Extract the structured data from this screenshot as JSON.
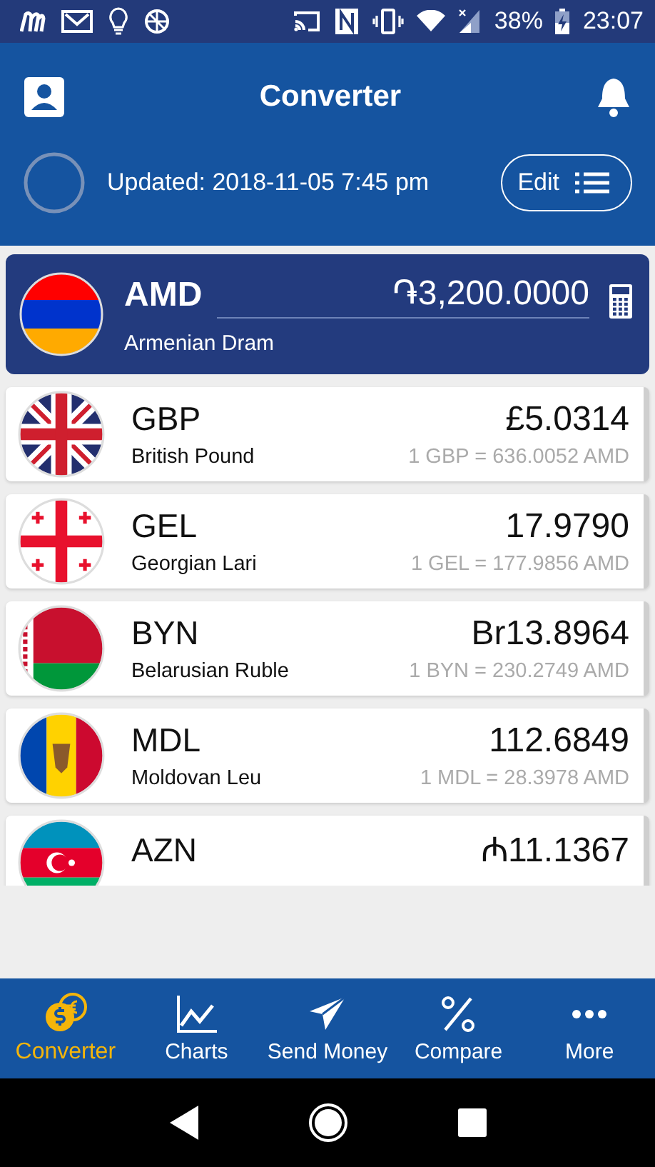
{
  "status_bar": {
    "battery": "38%",
    "time": "23:07"
  },
  "header": {
    "title": "Converter"
  },
  "update": {
    "text": "Updated: 2018-11-05 7:45 pm",
    "edit_label": "Edit"
  },
  "base": {
    "code": "AMD",
    "name": "Armenian Dram",
    "amount": "֏3,200.0000"
  },
  "rows": [
    {
      "code": "GBP",
      "name": "British Pound",
      "amount": "£5.0314",
      "rate": "1 GBP = 636.0052 AMD"
    },
    {
      "code": "GEL",
      "name": "Georgian Lari",
      "amount": "17.9790",
      "rate": "1 GEL = 177.9856 AMD"
    },
    {
      "code": "BYN",
      "name": "Belarusian Ruble",
      "amount": "Br13.8964",
      "rate": "1 BYN = 230.2749 AMD"
    },
    {
      "code": "MDL",
      "name": "Moldovan Leu",
      "amount": "112.6849",
      "rate": "1 MDL = 28.3978 AMD"
    },
    {
      "code": "AZN",
      "amount": "₼11.1367"
    }
  ],
  "nav": [
    {
      "label": "Converter",
      "selected": true
    },
    {
      "label": "Charts",
      "selected": false
    },
    {
      "label": "Send Money",
      "selected": false
    },
    {
      "label": "Compare",
      "selected": false
    },
    {
      "label": "More",
      "selected": false
    }
  ]
}
